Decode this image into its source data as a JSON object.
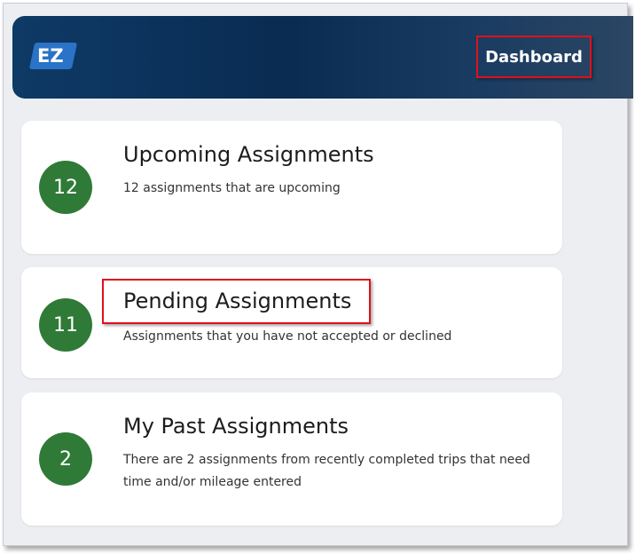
{
  "header": {
    "logo_text": "EZ",
    "nav_dashboard": "Dashboard"
  },
  "cards": [
    {
      "count": "12",
      "title": "Upcoming Assignments",
      "description": "12 assignments that are upcoming"
    },
    {
      "count": "11",
      "title": "Pending Assignments",
      "description": "Assignments that you have not accepted or declined"
    },
    {
      "count": "2",
      "title": "My Past Assignments",
      "description": "There are 2 assignments from recently completed trips that need time and/or mileage entered"
    }
  ],
  "colors": {
    "header_dark": "#0a2b52",
    "logo_blue": "#2a73c6",
    "badge_green": "#2f7a37",
    "highlight_red": "#e0101a",
    "page_bg": "#eceef1"
  }
}
